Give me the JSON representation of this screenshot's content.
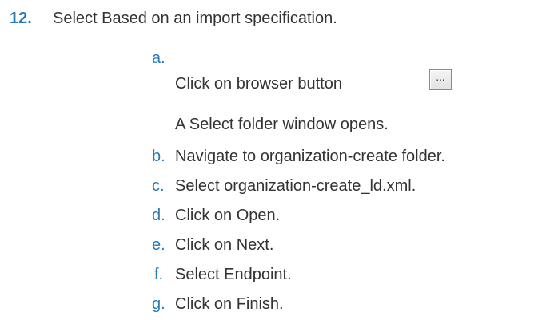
{
  "step": {
    "number": "12.",
    "text": "Select Based on an import specification."
  },
  "substeps": [
    {
      "letter": "a.",
      "text": "Click on browser button"
    },
    {
      "letter": "",
      "text": "A Select folder window opens."
    },
    {
      "letter": "b.",
      "text": "Navigate to organization-create folder."
    },
    {
      "letter": "c.",
      "text": "Select organization-create_ld.xml."
    },
    {
      "letter": "d.",
      "text": "Click on Open."
    },
    {
      "letter": "e.",
      "text": "Click on Next."
    },
    {
      "letter": "f.",
      "text": "Select Endpoint."
    },
    {
      "letter": "g.",
      "text": "Click on Finish."
    }
  ],
  "browse_button": {
    "label": "...",
    "icon": "ellipsis-icon"
  },
  "colors": {
    "accent": "#2a7bb8",
    "text": "#333333"
  }
}
